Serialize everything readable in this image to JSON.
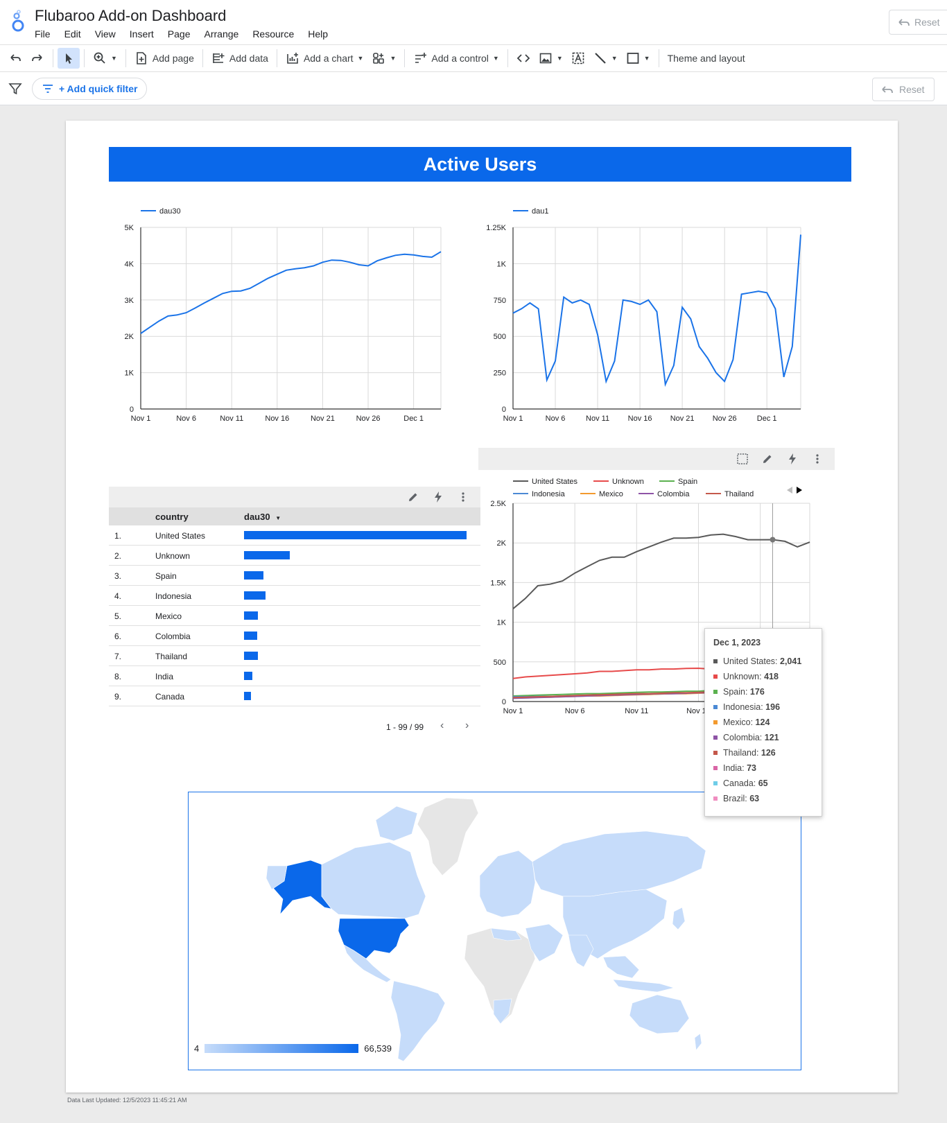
{
  "app": {
    "title": "Flubaroo Add-on Dashboard",
    "menu": [
      "File",
      "Edit",
      "View",
      "Insert",
      "Page",
      "Arrange",
      "Resource",
      "Help"
    ],
    "reset_label": "Reset"
  },
  "toolbar": {
    "add_page": "Add page",
    "add_data": "Add data",
    "add_chart": "Add a chart",
    "add_control": "Add a control",
    "theme": "Theme and layout"
  },
  "filterbar": {
    "quick_filter": "+ Add quick filter",
    "reset_label": "Reset"
  },
  "banner": {
    "title": "Active Users"
  },
  "charts": {
    "c4_legend_pager": "◀ ▶"
  },
  "chart_data": [
    {
      "type": "line",
      "series": [
        {
          "name": "dau30",
          "color": "#1a73e8",
          "values": [
            2080,
            2250,
            2420,
            2560,
            2590,
            2650,
            2780,
            2920,
            3050,
            3180,
            3240,
            3250,
            3320,
            3460,
            3600,
            3710,
            3820,
            3860,
            3890,
            3940,
            4040,
            4100,
            4090,
            4040,
            3970,
            3940,
            4080,
            4160,
            4230,
            4260,
            4240,
            4200,
            4180,
            4330
          ]
        }
      ],
      "x_ticks": [
        "Nov 1",
        "Nov 6",
        "Nov 11",
        "Nov 16",
        "Nov 21",
        "Nov 26",
        "Dec 1"
      ],
      "y_ticks": [
        "0",
        "1K",
        "2K",
        "3K",
        "4K",
        "5K"
      ],
      "ylim": [
        0,
        5000
      ],
      "grid": true,
      "legend": "top-left"
    },
    {
      "type": "line",
      "series": [
        {
          "name": "dau1",
          "color": "#1a73e8",
          "values": [
            660,
            690,
            730,
            690,
            200,
            330,
            770,
            730,
            750,
            720,
            510,
            190,
            330,
            750,
            740,
            720,
            750,
            670,
            170,
            300,
            700,
            620,
            430,
            350,
            250,
            190,
            340,
            790,
            800,
            810,
            800,
            690,
            220,
            430,
            1200
          ]
        }
      ],
      "x_ticks": [
        "Nov 1",
        "Nov 6",
        "Nov 11",
        "Nov 16",
        "Nov 21",
        "Nov 26",
        "Dec 1"
      ],
      "y_ticks": [
        "0",
        "250",
        "500",
        "750",
        "1K",
        "1.25K"
      ],
      "ylim": [
        0,
        1250
      ],
      "grid": true,
      "legend": "top-left"
    },
    {
      "type": "table",
      "columns": [
        "country",
        "dau30"
      ],
      "sort_indicator": "▼",
      "rows": [
        {
          "rank": "1.",
          "country": "United States",
          "value": 2041
        },
        {
          "rank": "2.",
          "country": "Unknown",
          "value": 418
        },
        {
          "rank": "3.",
          "country": "Spain",
          "value": 176
        },
        {
          "rank": "4.",
          "country": "Indonesia",
          "value": 196
        },
        {
          "rank": "5.",
          "country": "Mexico",
          "value": 124
        },
        {
          "rank": "6.",
          "country": "Colombia",
          "value": 121
        },
        {
          "rank": "7.",
          "country": "Thailand",
          "value": 126
        },
        {
          "rank": "8.",
          "country": "India",
          "value": 73
        },
        {
          "rank": "9.",
          "country": "Canada",
          "value": 65
        }
      ],
      "pagination": "1 - 99 / 99"
    },
    {
      "type": "line",
      "x_ticks": [
        "Nov 1",
        "Nov 6",
        "Nov 11",
        "Nov 16",
        "No"
      ],
      "y_ticks": [
        "0",
        "500",
        "1K",
        "1.5K",
        "2K",
        "2.5K"
      ],
      "ylim": [
        0,
        2500
      ],
      "grid": true,
      "legend": "top",
      "series": [
        {
          "name": "United States",
          "color": "#595959",
          "values": [
            1170,
            1300,
            1460,
            1480,
            1520,
            1620,
            1700,
            1780,
            1820,
            1820,
            1890,
            1950,
            2010,
            2060,
            2060,
            2070,
            2100,
            2110,
            2080,
            2040,
            2040,
            2041,
            2020,
            1950,
            2010
          ]
        },
        {
          "name": "Unknown",
          "color": "#e74a4a",
          "values": [
            290,
            310,
            320,
            330,
            340,
            350,
            360,
            380,
            380,
            390,
            400,
            400,
            410,
            410,
            418,
            420,
            410,
            410,
            400,
            400,
            410,
            418,
            410,
            400,
            410
          ]
        },
        {
          "name": "Spain",
          "color": "#5bb14f",
          "values": [
            70,
            75,
            80,
            85,
            90,
            95,
            100,
            100,
            105,
            110,
            115,
            120,
            120,
            125,
            130,
            130,
            140,
            150,
            150,
            160,
            165,
            176,
            170,
            160,
            180
          ]
        },
        {
          "name": "Indonesia",
          "color": "#4b89d4",
          "values": [
            60,
            60,
            65,
            65,
            70,
            75,
            75,
            80,
            80,
            85,
            90,
            90,
            95,
            100,
            100,
            110,
            120,
            130,
            140,
            150,
            160,
            196,
            200,
            210,
            250
          ]
        },
        {
          "name": "Mexico",
          "color": "#f39a2e",
          "values": [
            45,
            50,
            55,
            55,
            60,
            65,
            70,
            70,
            75,
            80,
            85,
            90,
            95,
            100,
            100,
            105,
            110,
            110,
            115,
            120,
            120,
            124,
            120,
            120,
            125
          ]
        },
        {
          "name": "Colombia",
          "color": "#8e54a6",
          "values": [
            40,
            45,
            50,
            55,
            60,
            65,
            70,
            75,
            80,
            85,
            90,
            95,
            100,
            100,
            105,
            110,
            110,
            115,
            115,
            120,
            120,
            121,
            120,
            120,
            125
          ]
        },
        {
          "name": "Thailand",
          "color": "#c4584b",
          "values": [
            50,
            55,
            60,
            65,
            70,
            75,
            80,
            85,
            90,
            95,
            100,
            100,
            105,
            110,
            110,
            115,
            120,
            120,
            125,
            125,
            126,
            126,
            125,
            130,
            140
          ]
        }
      ],
      "tooltip": {
        "title": "Dec 1, 2023",
        "items": [
          {
            "label": "United States: ",
            "value": "2,041",
            "color": "#595959"
          },
          {
            "label": "Unknown: ",
            "value": "418",
            "color": "#e74a4a"
          },
          {
            "label": "Spain: ",
            "value": "176",
            "color": "#5bb14f"
          },
          {
            "label": "Indonesia: ",
            "value": "196",
            "color": "#4b89d4"
          },
          {
            "label": "Mexico: ",
            "value": "124",
            "color": "#f39a2e"
          },
          {
            "label": "Colombia: ",
            "value": "121",
            "color": "#8e54a6"
          },
          {
            "label": "Thailand: ",
            "value": "126",
            "color": "#c4584b"
          },
          {
            "label": "India: ",
            "value": "73",
            "color": "#d966a6"
          },
          {
            "label": "Canada: ",
            "value": "65",
            "color": "#6fcde8"
          },
          {
            "label": "Brazil: ",
            "value": "63",
            "color": "#f08dc0"
          }
        ]
      }
    },
    {
      "type": "map",
      "color_scale": {
        "min_label": "4",
        "max_label": "66,539",
        "min_color": "#c6dcfa",
        "max_color": "#0a68ea"
      },
      "highlighted": [
        "United States",
        "Alaska"
      ]
    }
  ],
  "footer": "Data Last Updated: 12/5/2023 11:45:21 AM"
}
